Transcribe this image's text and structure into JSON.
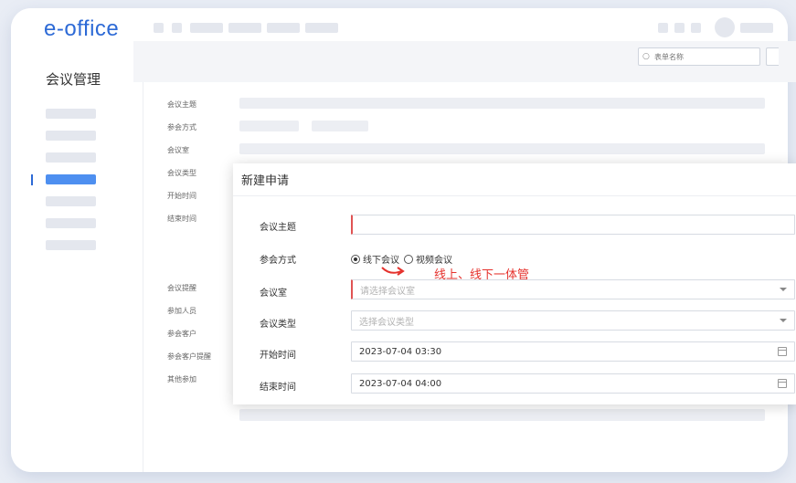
{
  "app": {
    "logo": "e-office",
    "module_title": "会议管理"
  },
  "toolbar": {
    "search_placeholder": "表单名称"
  },
  "background_form": {
    "labels": [
      "会议主题",
      "参会方式",
      "会议室",
      "会议类型",
      "开始时间",
      "结束时间",
      "会议提醒",
      "参加人员",
      "参会客户",
      "参会客户提醒",
      "其他参加"
    ]
  },
  "dialog": {
    "title": "新建申请",
    "fields": {
      "subject": {
        "label": "会议主题",
        "value": ""
      },
      "mode": {
        "label": "参会方式",
        "options": [
          "线下会议",
          "视频会议"
        ],
        "selected": "线下会议"
      },
      "room": {
        "label": "会议室",
        "placeholder": "请选择会议室"
      },
      "type": {
        "label": "会议类型",
        "placeholder": "选择会议类型"
      },
      "start": {
        "label": "开始时间",
        "value": "2023-07-04 03:30"
      },
      "end": {
        "label": "结束时间",
        "value": "2023-07-04 04:00"
      }
    }
  },
  "annotation": {
    "text": "线上、线下一体管",
    "color": "#e5322d"
  },
  "colors": {
    "brand": "#2d6ad6",
    "required": "#e05353"
  }
}
